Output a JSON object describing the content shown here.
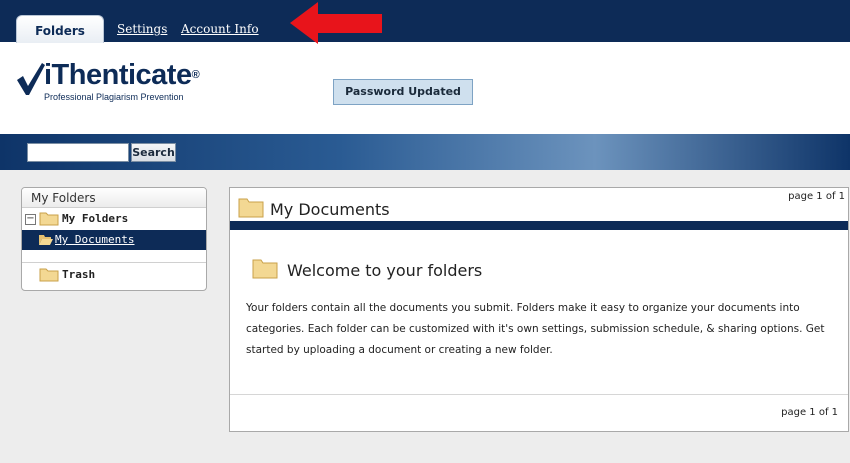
{
  "nav": {
    "active_tab": "Folders",
    "links": [
      "Settings",
      "Account Info"
    ]
  },
  "brand": {
    "name": "iThenticate",
    "registered": "®",
    "tagline": "Professional Plagiarism Prevention"
  },
  "notice": "Password Updated",
  "search": {
    "value": "",
    "button_label": "Search"
  },
  "sidebar": {
    "title": "My Folders",
    "root": {
      "label": "My Folders",
      "toggle": "−"
    },
    "items": [
      {
        "label": "My Documents",
        "selected": true
      },
      {
        "label": "Trash",
        "selected": false
      }
    ]
  },
  "panel": {
    "title": "My Documents",
    "pager_top": "page 1 of 1",
    "welcome_title": "Welcome to your folders",
    "body": "Your folders contain all the documents you submit. Folders make it easy to organize your documents into categories. Each folder can be customized with it's own settings, submission schedule, & sharing options. Get started by uploading a document or creating a new folder.",
    "pager_bottom": "page 1 of 1"
  },
  "colors": {
    "navy": "#0d2b57",
    "notice_bg": "#cfe0ee",
    "arrow": "#e8141b",
    "main_bg": "#ededed",
    "folder": "#f3d893"
  },
  "icons": {
    "logo": "checkmark-icon",
    "folder": "folder-icon",
    "open_folder": "open-folder-icon",
    "annotation": "red-arrow-icon"
  }
}
